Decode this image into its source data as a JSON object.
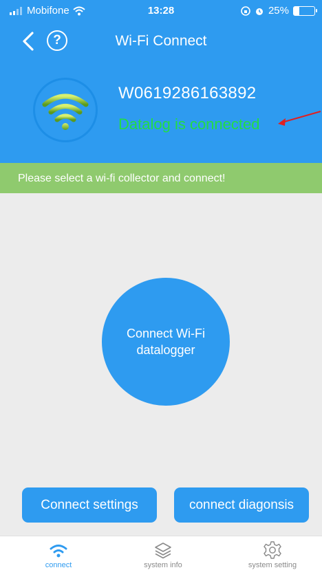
{
  "status_bar": {
    "carrier": "Mobifone",
    "time": "13:28",
    "battery_percent": "25%",
    "battery_level": 0.25
  },
  "nav": {
    "title": "Wi-Fi Connect",
    "help_symbol": "?"
  },
  "device": {
    "id": "W0619286163892",
    "status": "Datalog is connected",
    "status_color": "#22dd44"
  },
  "notice": "Please select a wi-fi collector and connect!",
  "main": {
    "connect_button": "Connect Wi-Fi datalogger"
  },
  "actions": {
    "settings_label": "Connect settings",
    "diagnosis_label": "connect diagonsis"
  },
  "tabs": [
    {
      "label": "connect",
      "icon": "wifi-icon",
      "active": true
    },
    {
      "label": "system info",
      "icon": "layers-icon",
      "active": false
    },
    {
      "label": "system setting",
      "icon": "gear-icon",
      "active": false
    }
  ],
  "colors": {
    "primary": "#2e9bf0",
    "notice_bg": "#8fca6e",
    "arrow": "#e02020",
    "tab_active": "#2e9bf0",
    "tab_inactive": "#8a8a8a"
  }
}
